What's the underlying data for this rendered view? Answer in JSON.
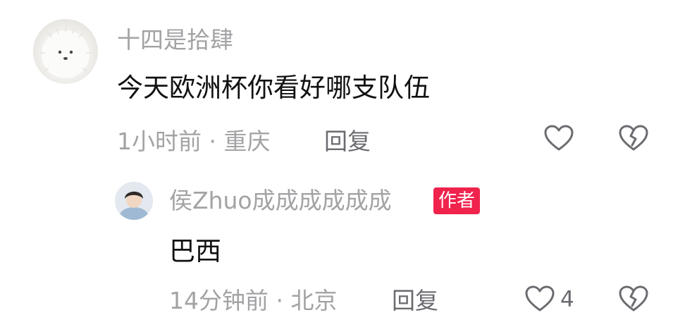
{
  "comment": {
    "username": "十四是拾肆",
    "text": "今天欧洲杯你看好哪支队伍",
    "time_location": "1小时前 · 重庆",
    "reply_label": "回复",
    "like_count": "",
    "avatar_icon": "white-fluffy-creature-avatar"
  },
  "reply": {
    "username": "侯Zhuo成成成成成成",
    "author_badge": "作者",
    "text": "巴西",
    "time_location": "14分钟前 · 北京",
    "reply_label": "回复",
    "like_count": "4",
    "avatar_icon": "person-photo-avatar"
  },
  "icons": {
    "like": "heart-outline-icon",
    "dislike": "broken-heart-outline-icon"
  },
  "colors": {
    "badge_bg": "#f0234d",
    "muted_text": "#a3a3a6",
    "primary_text": "#111111",
    "icon_stroke": "#6b6b70"
  }
}
